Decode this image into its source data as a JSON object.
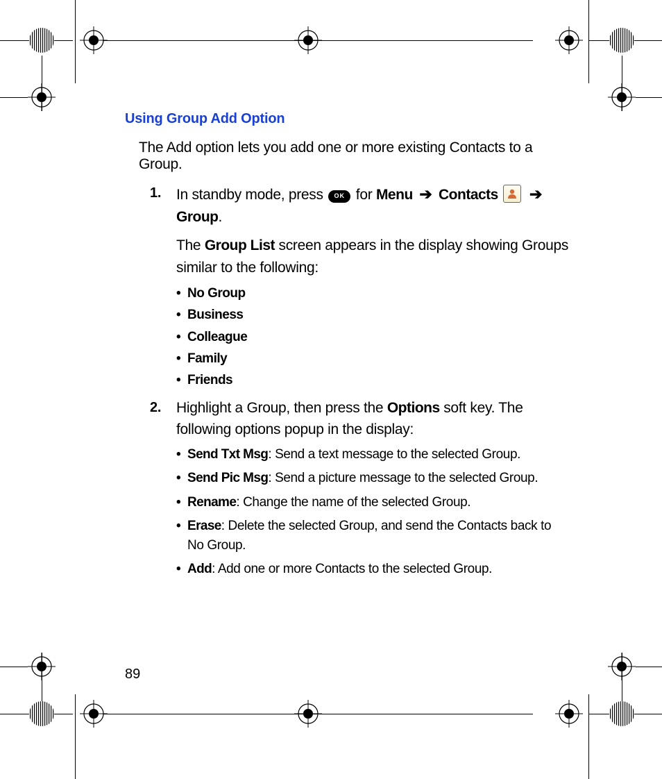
{
  "heading": "Using Group Add Option",
  "intro": "The Add option lets you add one or more existing Contacts to a Group.",
  "step1": {
    "pre": "In standby mode, press ",
    "for": " for ",
    "menu": "Menu",
    "arrow1": "➔",
    "contacts": "Contacts",
    "arrow2": "➔",
    "group": "Group",
    "period": ".",
    "ok_label": "OK",
    "para_pre": "The ",
    "group_list": "Group List",
    "para_post": " screen appears in the display showing Groups similar to the following:"
  },
  "groups": [
    "No Group",
    "Business",
    "Colleague",
    "Family",
    "Friends"
  ],
  "step2": {
    "pre": "Highlight a Group, then press the ",
    "options": "Options",
    "post": " soft key. The following options popup in the display:"
  },
  "options_list": [
    {
      "name": "Send Txt Msg",
      "desc": ": Send a text message to the selected Group."
    },
    {
      "name": "Send Pic Msg",
      "desc": ": Send a picture message to the selected Group."
    },
    {
      "name": "Rename",
      "desc": ": Change the name of the selected Group."
    },
    {
      "name": "Erase",
      "desc": ": Delete the selected Group, and send the Contacts back to No Group."
    },
    {
      "name": "Add",
      "desc": ": Add one or more Contacts to the selected Group."
    }
  ],
  "page_number": "89"
}
